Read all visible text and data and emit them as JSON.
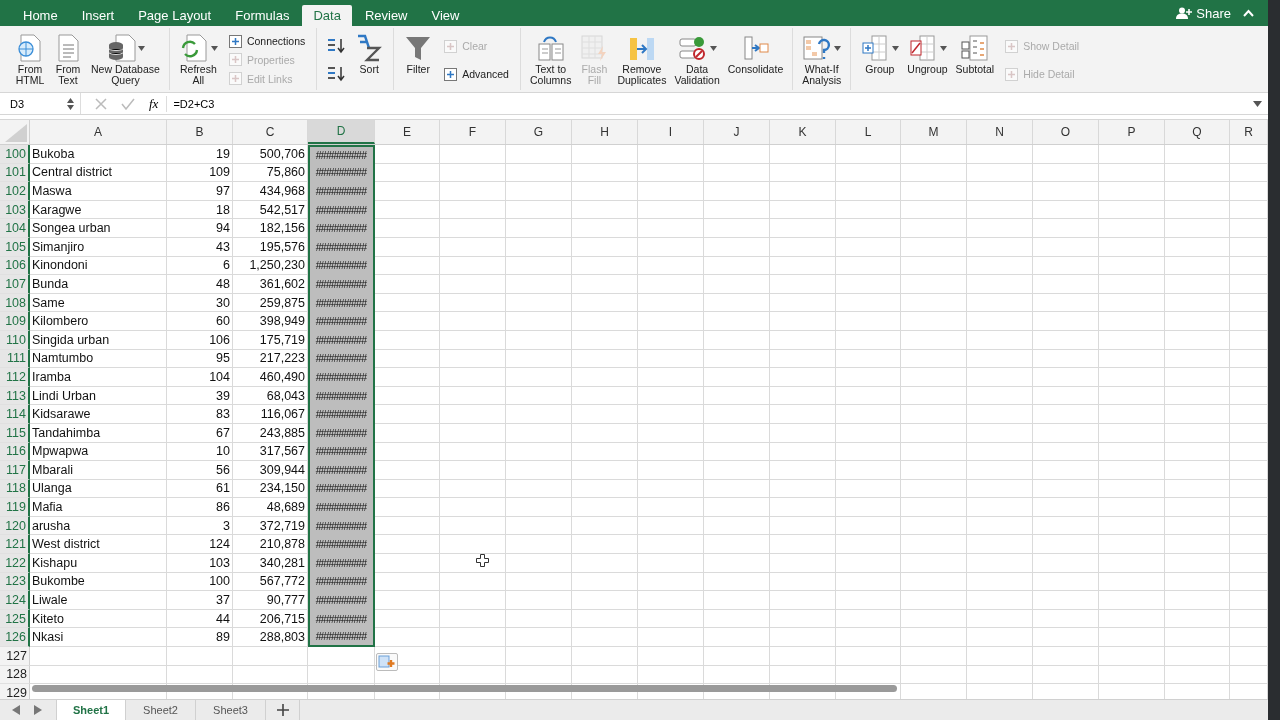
{
  "tabs": [
    {
      "label": "Home",
      "selected": false
    },
    {
      "label": "Insert",
      "selected": false
    },
    {
      "label": "Page Layout",
      "selected": false
    },
    {
      "label": "Formulas",
      "selected": false
    },
    {
      "label": "Data",
      "selected": true
    },
    {
      "label": "Review",
      "selected": false
    },
    {
      "label": "View",
      "selected": false
    }
  ],
  "share": "Share",
  "ribbon_groups": [
    {
      "items": [
        {
          "kind": "large",
          "lines": [
            "From",
            "HTML"
          ],
          "disabled": false,
          "dropdown": false
        },
        {
          "kind": "large",
          "lines": [
            "From",
            "Text"
          ],
          "disabled": false,
          "dropdown": false
        },
        {
          "kind": "large",
          "lines": [
            "New Database",
            "Query"
          ],
          "disabled": false,
          "dropdown": true
        }
      ]
    },
    {
      "items": [
        {
          "kind": "large",
          "lines": [
            "Refresh",
            "All"
          ],
          "disabled": false,
          "dropdown": true
        },
        {
          "kind": "stack",
          "entries": [
            {
              "label": "Connections",
              "disabled": false
            },
            {
              "label": "Properties",
              "disabled": true
            },
            {
              "label": "Edit Links",
              "disabled": true
            }
          ]
        }
      ]
    },
    {
      "items": [
        {
          "kind": "sortpair"
        },
        {
          "kind": "large",
          "lines": [
            "Sort"
          ],
          "disabled": false,
          "dropdown": false
        }
      ]
    },
    {
      "items": [
        {
          "kind": "large",
          "lines": [
            "Filter"
          ],
          "disabled": false,
          "dropdown": false
        },
        {
          "kind": "stack",
          "entries": [
            {
              "label": "Clear",
              "disabled": true
            },
            {
              "label": "Advanced",
              "disabled": false
            }
          ]
        }
      ]
    },
    {
      "items": [
        {
          "kind": "large",
          "lines": [
            "Text to",
            "Columns"
          ],
          "disabled": false,
          "dropdown": false
        },
        {
          "kind": "large",
          "lines": [
            "Flash",
            "Fill"
          ],
          "disabled": true,
          "dropdown": false
        },
        {
          "kind": "large",
          "lines": [
            "Remove",
            "Duplicates"
          ],
          "disabled": false,
          "dropdown": false
        },
        {
          "kind": "large",
          "lines": [
            "Data",
            "Validation"
          ],
          "disabled": false,
          "dropdown": true
        },
        {
          "kind": "large",
          "lines": [
            "Consolidate"
          ],
          "disabled": false,
          "dropdown": false
        }
      ]
    },
    {
      "items": [
        {
          "kind": "large",
          "lines": [
            "What-If",
            "Analysis"
          ],
          "disabled": false,
          "dropdown": true
        }
      ]
    },
    {
      "items": [
        {
          "kind": "large",
          "lines": [
            "Group"
          ],
          "disabled": false,
          "dropdown": true
        },
        {
          "kind": "large",
          "lines": [
            "Ungroup"
          ],
          "disabled": false,
          "dropdown": true
        },
        {
          "kind": "large",
          "lines": [
            "Subtotal"
          ],
          "disabled": false,
          "dropdown": false
        },
        {
          "kind": "stack",
          "entries": [
            {
              "label": "Show Detail",
              "disabled": true
            },
            {
              "label": "Hide Detail",
              "disabled": true
            }
          ]
        }
      ]
    }
  ],
  "formula_bar": {
    "name_box": "D3",
    "function_label": "fx",
    "formula": "=D2+C3"
  },
  "columns": [
    {
      "label": "A",
      "selected": false
    },
    {
      "label": "B",
      "selected": false
    },
    {
      "label": "C",
      "selected": false
    },
    {
      "label": "D",
      "selected": true
    },
    {
      "label": "E",
      "selected": false
    },
    {
      "label": "F",
      "selected": false
    },
    {
      "label": "G",
      "selected": false
    },
    {
      "label": "H",
      "selected": false
    },
    {
      "label": "I",
      "selected": false
    },
    {
      "label": "J",
      "selected": false
    },
    {
      "label": "K",
      "selected": false
    },
    {
      "label": "L",
      "selected": false
    },
    {
      "label": "M",
      "selected": false
    },
    {
      "label": "N",
      "selected": false
    },
    {
      "label": "O",
      "selected": false
    },
    {
      "label": "P",
      "selected": false
    },
    {
      "label": "Q",
      "selected": false
    },
    {
      "label": "R",
      "selected": false
    }
  ],
  "rows": [
    {
      "num": "100",
      "selected": true,
      "cells": [
        "Bukoba",
        "19",
        "500,706",
        "##########"
      ]
    },
    {
      "num": "101",
      "selected": true,
      "cells": [
        "Central district",
        "109",
        "75,860",
        "##########"
      ]
    },
    {
      "num": "102",
      "selected": true,
      "cells": [
        "Maswa",
        "97",
        "434,968",
        "##########"
      ]
    },
    {
      "num": "103",
      "selected": true,
      "cells": [
        "Karagwe",
        "18",
        "542,517",
        "##########"
      ]
    },
    {
      "num": "104",
      "selected": true,
      "cells": [
        "Songea urban",
        "94",
        "182,156",
        "##########"
      ]
    },
    {
      "num": "105",
      "selected": true,
      "cells": [
        "Simanjiro",
        "43",
        "195,576",
        "##########"
      ]
    },
    {
      "num": "106",
      "selected": true,
      "cells": [
        "Kinondoni",
        "6",
        "1,250,230",
        "##########"
      ]
    },
    {
      "num": "107",
      "selected": true,
      "cells": [
        "Bunda",
        "48",
        "361,602",
        "##########"
      ]
    },
    {
      "num": "108",
      "selected": true,
      "cells": [
        "Same",
        "30",
        "259,875",
        "##########"
      ]
    },
    {
      "num": "109",
      "selected": true,
      "cells": [
        "Kilombero",
        "60",
        "398,949",
        "##########"
      ]
    },
    {
      "num": "110",
      "selected": true,
      "cells": [
        "Singida urban",
        "106",
        "175,719",
        "##########"
      ]
    },
    {
      "num": "111",
      "selected": true,
      "cells": [
        "Namtumbo",
        "95",
        "217,223",
        "##########"
      ]
    },
    {
      "num": "112",
      "selected": true,
      "cells": [
        "Iramba",
        "104",
        "460,490",
        "##########"
      ]
    },
    {
      "num": "113",
      "selected": true,
      "cells": [
        "Lindi Urban",
        "39",
        "68,043",
        "##########"
      ]
    },
    {
      "num": "114",
      "selected": true,
      "cells": [
        "Kidsarawe",
        "83",
        "116,067",
        "##########"
      ]
    },
    {
      "num": "115",
      "selected": true,
      "cells": [
        "Tandahimba",
        "67",
        "243,885",
        "##########"
      ]
    },
    {
      "num": "116",
      "selected": true,
      "cells": [
        "Mpwapwa",
        "10",
        "317,567",
        "##########"
      ]
    },
    {
      "num": "117",
      "selected": true,
      "cells": [
        "Mbarali",
        "56",
        "309,944",
        "##########"
      ]
    },
    {
      "num": "118",
      "selected": true,
      "cells": [
        "Ulanga",
        "61",
        "234,150",
        "##########"
      ]
    },
    {
      "num": "119",
      "selected": true,
      "cells": [
        "Mafia",
        "86",
        "48,689",
        "##########"
      ]
    },
    {
      "num": "120",
      "selected": true,
      "cells": [
        "arusha",
        "3",
        "372,719",
        "##########"
      ]
    },
    {
      "num": "121",
      "selected": true,
      "cells": [
        "West district",
        "124",
        "210,878",
        "##########"
      ]
    },
    {
      "num": "122",
      "selected": true,
      "cells": [
        "Kishapu",
        "103",
        "340,281",
        "##########"
      ]
    },
    {
      "num": "123",
      "selected": true,
      "cells": [
        "Bukombe",
        "100",
        "567,772",
        "##########"
      ]
    },
    {
      "num": "124",
      "selected": true,
      "cells": [
        "Liwale",
        "37",
        "90,777",
        "##########"
      ]
    },
    {
      "num": "125",
      "selected": true,
      "cells": [
        "Kiteto",
        "44",
        "206,715",
        "##########"
      ]
    },
    {
      "num": "126",
      "selected": true,
      "cells": [
        "Nkasi",
        "89",
        "288,803",
        "##########"
      ]
    },
    {
      "num": "127",
      "selected": false
    },
    {
      "num": "128",
      "selected": false
    },
    {
      "num": "129",
      "selected": false
    }
  ],
  "sheet_tabs": [
    {
      "label": "Sheet1",
      "selected": true
    },
    {
      "label": "Sheet2",
      "selected": false
    },
    {
      "label": "Sheet3",
      "selected": false
    }
  ]
}
